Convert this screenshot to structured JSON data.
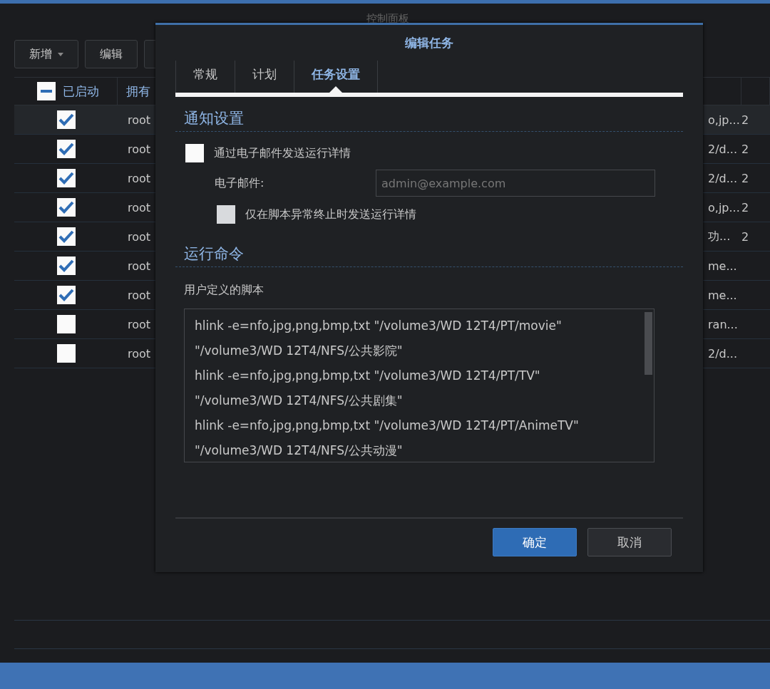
{
  "window": {
    "title": "控制面板"
  },
  "toolbar": [
    {
      "label": "新增",
      "dropdown": true
    },
    {
      "label": "编辑",
      "dropdown": false
    }
  ],
  "table": {
    "header_checkbox": {
      "indeterminate": true
    },
    "columns": [
      "已启动",
      "拥有"
    ],
    "rows": [
      {
        "enabled": true,
        "owner": "root",
        "column_3": "o,jp...",
        "column_4": "2",
        "selected": true
      },
      {
        "enabled": true,
        "owner": "root",
        "column_3": "2/d...",
        "column_4": "2",
        "selected": false
      },
      {
        "enabled": true,
        "owner": "root",
        "column_3": "2/d...",
        "column_4": "2",
        "selected": false
      },
      {
        "enabled": true,
        "owner": "root",
        "column_3": "o,jp...",
        "column_4": "2",
        "selected": false
      },
      {
        "enabled": true,
        "owner": "root",
        "column_3": "功...",
        "column_4": "2",
        "selected": false
      },
      {
        "enabled": true,
        "owner": "root",
        "column_3": "me...",
        "selected": false
      },
      {
        "enabled": true,
        "owner": "root",
        "column_3": "me...",
        "selected": false
      },
      {
        "enabled": false,
        "owner": "root",
        "column_3": "ran...",
        "selected": false
      },
      {
        "enabled": false,
        "owner": "root",
        "column_3": "2/d...",
        "selected": false
      }
    ]
  },
  "dialog": {
    "title": "编辑任务",
    "tabs": [
      {
        "label": "常规",
        "selected": false
      },
      {
        "label": "计划",
        "selected": false
      },
      {
        "label": "任务设置",
        "selected": true
      }
    ],
    "notify_section": "通知设置",
    "email_checkbox": {
      "label": "通过电子邮件发送运行详情",
      "checked": false
    },
    "email_label": "电子邮件:",
    "email_field": {
      "placeholder": "admin@example.com"
    },
    "abort_checkbox": {
      "label": "仅在脚本异常终止时发送运行详情",
      "checked": false,
      "disabled": true
    },
    "command_section": "运行命令",
    "script_label": "用户定义的脚本",
    "script_lines": [
      "hlink -e=nfo,jpg,png,bmp,txt \"/volume3/WD 12T4/PT/movie\"",
      "\"/volume3/WD 12T4/NFS/公共影院\"",
      "hlink -e=nfo,jpg,png,bmp,txt \"/volume3/WD 12T4/PT/TV\"",
      "\"/volume3/WD 12T4/NFS/公共剧集\"",
      "hlink -e=nfo,jpg,png,bmp,txt \"/volume3/WD 12T4/PT/AnimeTV\"",
      "\"/volume3/WD 12T4/NFS/公共动漫\""
    ],
    "buttons": [
      {
        "label": "确定",
        "kind": "primary"
      },
      {
        "label": "取消",
        "kind": "secondary"
      }
    ]
  }
}
